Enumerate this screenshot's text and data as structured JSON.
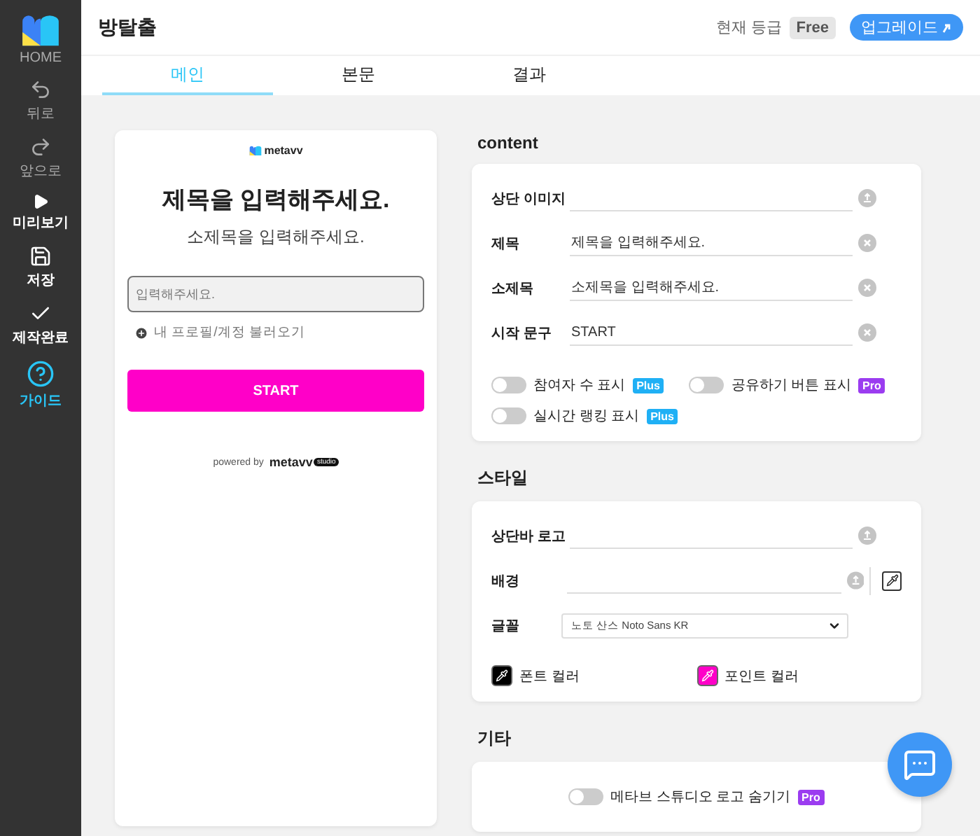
{
  "sidebar": {
    "items": [
      {
        "label": "HOME",
        "kind": "logo",
        "highlighted": false
      },
      {
        "label": "뒤로",
        "kind": "undo",
        "disabled": true,
        "highlighted": false
      },
      {
        "label": "앞으로",
        "kind": "redo",
        "disabled": true,
        "highlighted": false
      },
      {
        "label": "미리보기",
        "kind": "play",
        "disabled": false,
        "highlighted": false
      },
      {
        "label": "저장",
        "kind": "save",
        "disabled": false,
        "highlighted": false
      },
      {
        "label": "제작완료",
        "kind": "check",
        "disabled": false,
        "highlighted": false
      },
      {
        "label": "가이드",
        "kind": "help",
        "disabled": false,
        "highlighted": true
      }
    ]
  },
  "header": {
    "title": "방탈출",
    "grade_label": "현재 등급",
    "grade": "Free",
    "upgrade_button": "업그레이드"
  },
  "tabs": [
    {
      "label": "메인",
      "selected": true
    },
    {
      "label": "본문",
      "selected": false
    },
    {
      "label": "결과",
      "selected": false
    }
  ],
  "preview": {
    "logo": "metavv",
    "title": "제목을 입력해주세요.",
    "subtitle": "소제목을 입력해주세요.",
    "input_placeholder": "입력해주세요.",
    "profile_link": "내 프로필/계정 불러오기",
    "start_button": "START",
    "powered_by": "powered by",
    "brand": "metavv",
    "brand_badge": "studio"
  },
  "sections": [
    {
      "title": "content",
      "fields": [
        {
          "label": "상단 이미지",
          "kind": "upload"
        },
        {
          "label": "제목",
          "kind": "text",
          "value": "제목을 입력해주세요."
        },
        {
          "label": "소제목",
          "kind": "text",
          "value": "소제목을 입력해주세요."
        },
        {
          "label": "시작 문구",
          "kind": "text",
          "value": "START"
        }
      ],
      "toggles": [
        {
          "label": "참여자 수 표시",
          "on": false,
          "badge": {
            "text": "Plus",
            "color": "#1fb0f5"
          }
        },
        {
          "label": "공유하기 버튼 표시",
          "on": false,
          "badge": {
            "text": "Pro",
            "color": "#9b3cf0"
          }
        },
        {
          "label": "실시간 랭킹 표시",
          "on": false,
          "badge": {
            "text": "Plus",
            "color": "#1fb0f5"
          }
        }
      ]
    },
    {
      "title": "스타일",
      "fields": [
        {
          "label": "상단바 로고",
          "kind": "upload"
        },
        {
          "label": "배경",
          "kind": "upload_color"
        },
        {
          "label": "글꼴",
          "kind": "select",
          "value": "노토 산스 Noto Sans KR"
        }
      ],
      "colors": [
        {
          "label": "폰트 컬러",
          "color": "#000000"
        },
        {
          "label": "포인트 컬러",
          "color": "#ff00c8"
        }
      ]
    },
    {
      "title": "기타",
      "toggles": [
        {
          "label": "메타브 스튜디오 로고 숨기기",
          "on": false,
          "badge": {
            "text": "Pro",
            "color": "#9b3cf0"
          }
        }
      ]
    }
  ]
}
